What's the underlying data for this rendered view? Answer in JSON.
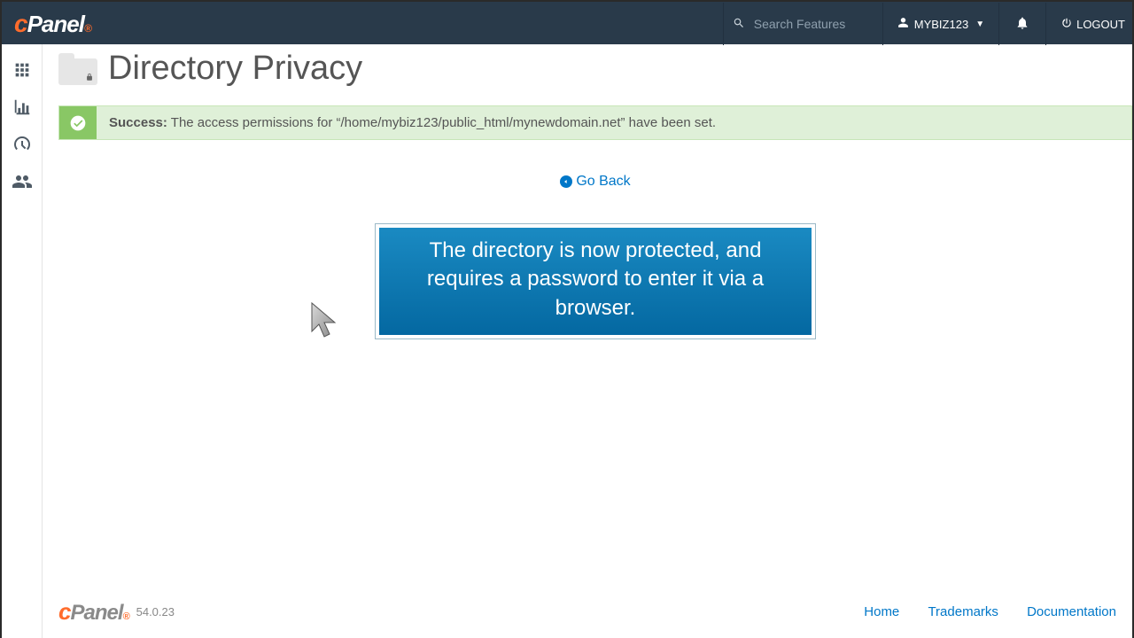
{
  "header": {
    "logo_c": "c",
    "logo_rest": "Panel",
    "search_placeholder": "Search Features",
    "username": "MYBIZ123",
    "logout_label": "LOGOUT"
  },
  "sidebar": {
    "items": [
      {
        "name": "apps-icon"
      },
      {
        "name": "stats-icon"
      },
      {
        "name": "dashboard-icon"
      },
      {
        "name": "users-icon"
      }
    ]
  },
  "page": {
    "title": "Directory Privacy",
    "alert_label": "Success:",
    "alert_message": "The access permissions for “/home/mybiz123/public_html/mynewdomain.net” have been set.",
    "go_back_label": "Go Back",
    "callout_text": "The directory is now protected, and requires a password to enter it via a browser."
  },
  "footer": {
    "logo_c": "c",
    "logo_rest": "Panel",
    "version": "54.0.23",
    "links": {
      "home": "Home",
      "trademarks": "Trademarks",
      "documentation": "Documentation"
    }
  }
}
